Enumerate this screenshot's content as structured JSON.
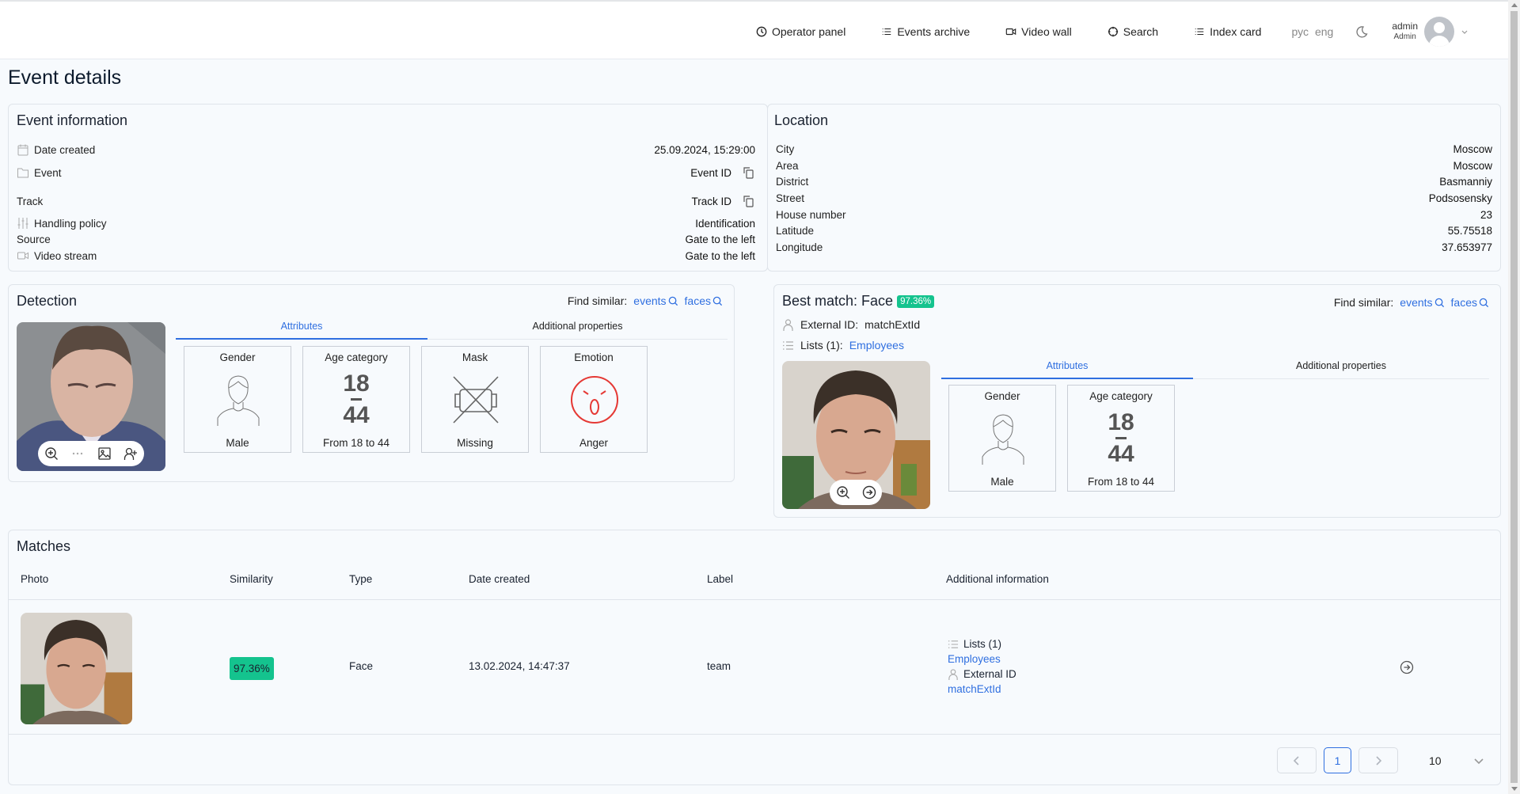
{
  "header": {
    "nav": [
      {
        "icon": "clock-icon",
        "label": "Operator panel"
      },
      {
        "icon": "list-icon",
        "label": "Events archive"
      },
      {
        "icon": "video-icon",
        "label": "Video wall"
      },
      {
        "icon": "search-circle-icon",
        "label": "Search"
      },
      {
        "icon": "list-icon",
        "label": "Index card"
      }
    ],
    "languages": [
      "рус",
      "eng"
    ],
    "user": {
      "name": "admin",
      "role": "Admin"
    }
  },
  "page_title": "Event details",
  "event_info": {
    "title": "Event information",
    "rows": [
      {
        "label": "Date created",
        "value": "25.09.2024, 15:29:00"
      },
      {
        "label": "Event",
        "value": "Event ID"
      },
      {
        "label": "Track",
        "value": "Track ID"
      },
      {
        "label": "Handling policy",
        "value": "Identification"
      },
      {
        "label": "Source",
        "value": "Gate to the left"
      },
      {
        "label": "Video stream",
        "value": "Gate to the left"
      }
    ]
  },
  "location": {
    "title": "Location",
    "rows": [
      {
        "label": "City",
        "value": "Moscow"
      },
      {
        "label": "Area",
        "value": "Moscow"
      },
      {
        "label": "District",
        "value": "Basmanniy"
      },
      {
        "label": "Street",
        "value": "Podsosensky"
      },
      {
        "label": "House number",
        "value": "23"
      },
      {
        "label": "Latitude",
        "value": "55.75518"
      },
      {
        "label": "Longitude",
        "value": "37.653977"
      }
    ]
  },
  "detection": {
    "title": "Detection",
    "find_similar": {
      "label": "Find similar:",
      "events": "events",
      "faces": "faces"
    },
    "tabs": [
      "Attributes",
      "Additional properties"
    ],
    "attributes": [
      {
        "title": "Gender",
        "value": "Male"
      },
      {
        "title": "Age category",
        "value": "From 18 to 44",
        "age_from": "18",
        "age_to": "44"
      },
      {
        "title": "Mask",
        "value": "Missing"
      },
      {
        "title": "Emotion",
        "value": "Anger"
      }
    ]
  },
  "best_match": {
    "title": "Best match: Face",
    "similarity": "97.36%",
    "external_id_label": "External ID:",
    "external_id": "matchExtId",
    "lists_label": "Lists (1):",
    "list": "Employees",
    "find_similar": {
      "label": "Find similar:",
      "events": "events",
      "faces": "faces"
    },
    "tabs": [
      "Attributes",
      "Additional properties"
    ],
    "attributes": [
      {
        "title": "Gender",
        "value": "Male"
      },
      {
        "title": "Age category",
        "value": "From 18 to 44",
        "age_from": "18",
        "age_to": "44"
      }
    ]
  },
  "matches": {
    "title": "Matches",
    "columns": [
      "Photo",
      "Similarity",
      "Type",
      "Date created",
      "Label",
      "Additional information"
    ],
    "rows": [
      {
        "similarity": "97.36%",
        "type": "Face",
        "date_created": "13.02.2024, 14:47:37",
        "label": "team",
        "lists_label": "Lists (1)",
        "list": "Employees",
        "external_id_label": "External ID",
        "external_id": "matchExtId"
      }
    ],
    "pagination": {
      "current_page": "1",
      "page_size": "10"
    }
  },
  "colors": {
    "accent": "#2f6fe0",
    "similarity_badge": "#14c38e",
    "emotion": "#e53935"
  }
}
